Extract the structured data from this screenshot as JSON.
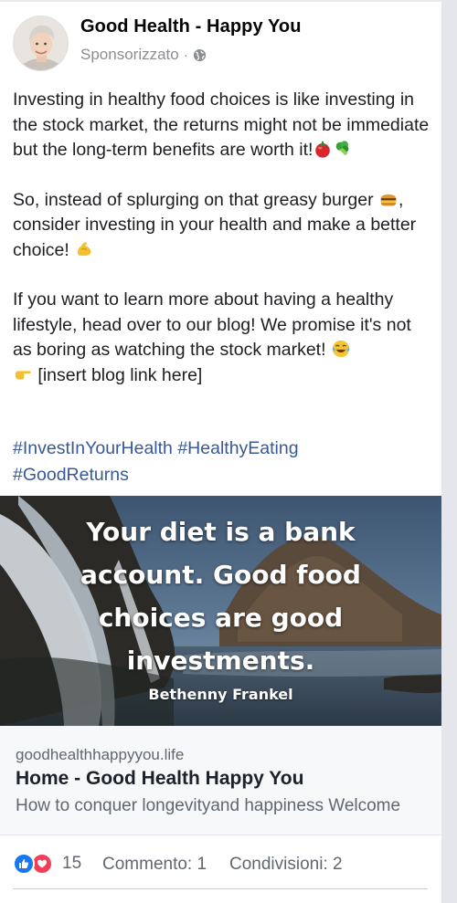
{
  "post": {
    "author": "Good Health - Happy You",
    "sponsored": "Sponsorizzato",
    "meta_separator": "·",
    "paragraphs": [
      {
        "text": "Investing in healthy food choices is like investing in the stock market, the returns might not be immediate but the long-term benefits are worth it!",
        "emojis": [
          "tomato-emoji",
          "broccoli-emoji"
        ]
      },
      {
        "text_before": "So, instead of splurging on that greasy burger",
        "emoji_mid": "burger-emoji",
        "text_after": ", consider investing in your health and make a better choice!",
        "emoji_end": "flexed-biceps-emoji"
      },
      {
        "text_before": "If you want to learn more about having a healthy lifestyle, head over to our blog! We promise it's not as boring as watching the stock market!",
        "emoji_a": "tears-of-joy-emoji",
        "emoji_b": "pointing-right-emoji",
        "text_after": "[insert blog link here]"
      }
    ],
    "hashtags": [
      "#InvestInYourHealth",
      "#HealthyEating",
      "#GoodReturns"
    ]
  },
  "image": {
    "quote_lines": [
      "Your diet is a bank",
      "account. Good food",
      "choices are good",
      "investments."
    ],
    "author": "Bethenny Frankel"
  },
  "link_preview": {
    "domain": "goodhealthhappyyou.life",
    "title": "Home - Good Health Happy You",
    "description": "How to conquer longevityand happiness Welcome"
  },
  "footer": {
    "reactions_count": "15",
    "comments": "Commento: 1",
    "shares": "Condivisioni: 2"
  },
  "colors": {
    "hashtag": "#385898",
    "like": "#1877f2",
    "love": "#f33e58",
    "meta_gray": "#8a8d91"
  }
}
